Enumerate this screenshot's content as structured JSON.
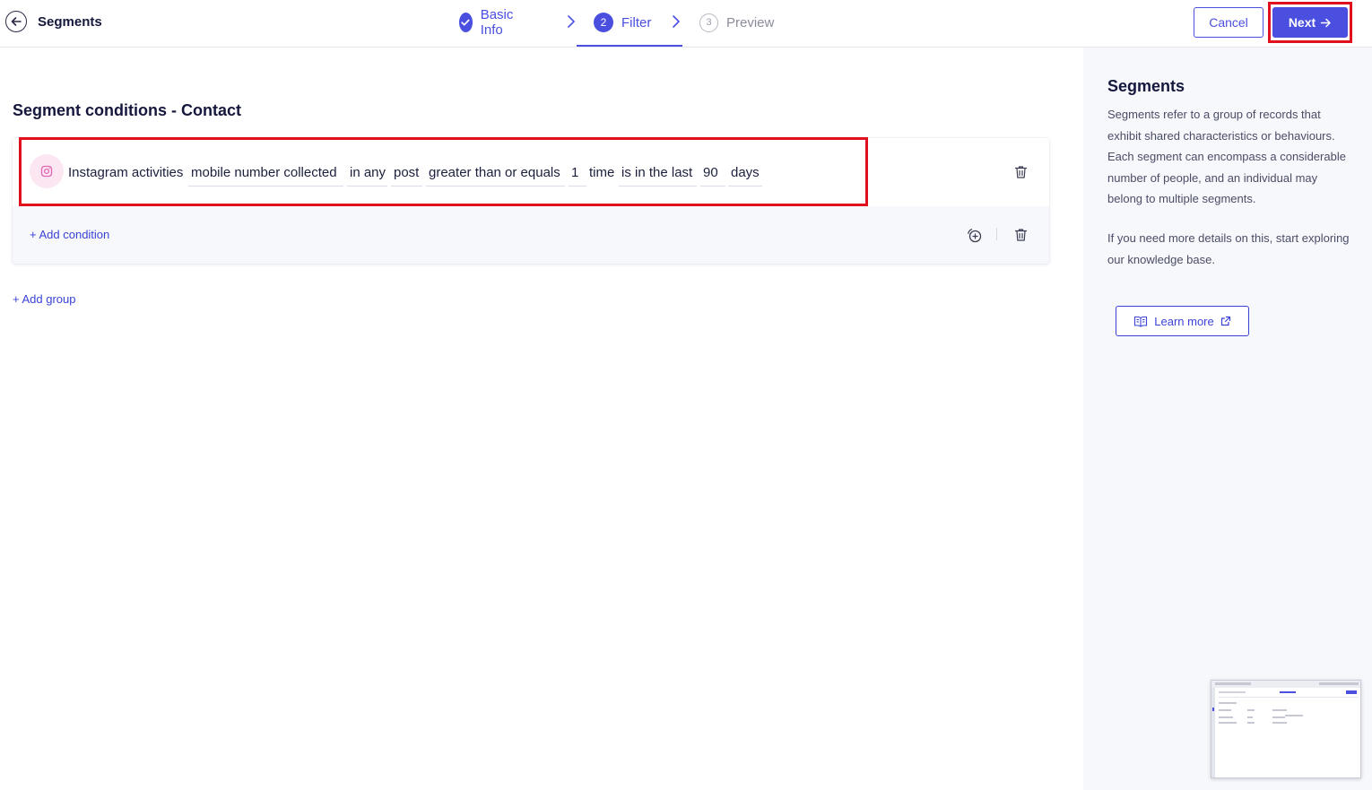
{
  "header": {
    "title": "Segments",
    "steps": [
      {
        "number": "1",
        "label": "Basic Info",
        "state": "done"
      },
      {
        "number": "2",
        "label": "Filter",
        "state": "active"
      },
      {
        "number": "3",
        "label": "Preview",
        "state": "pending"
      }
    ],
    "cancel_label": "Cancel",
    "next_label": "Next"
  },
  "main": {
    "title": "Segment conditions - Contact",
    "condition": {
      "source": "Instagram activities",
      "tokens": [
        "mobile number collected",
        "in any",
        "post",
        "greater than or equals",
        "1",
        "time",
        "is in the last",
        "90",
        "days"
      ]
    },
    "add_condition_label": "+ Add condition",
    "add_group_label": "+ Add group"
  },
  "side": {
    "title": "Segments",
    "description": "Segments refer to a group of records that exhibit shared characteristics or behaviours. Each segment can encompass a considerable number of people, and an individual may belong to multiple segments.",
    "description2": "If you need more details on this, start exploring our knowledge base.",
    "learn_more_label": "Learn more"
  },
  "colors": {
    "accent": "#4a4fe0",
    "highlight": "#e0101e",
    "instagram_badge": "#fbe6f2"
  }
}
